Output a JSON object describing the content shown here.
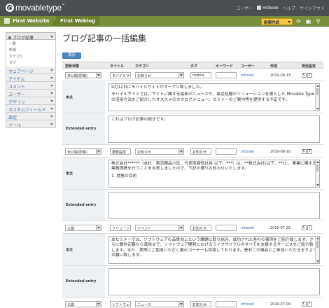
{
  "header": {
    "logo": "movabletype",
    "logo_tm": "™",
    "user_label": "ユーザー",
    "user_name": "mtbook",
    "help": "ヘルプ",
    "signout": "サインアウト"
  },
  "nav": {
    "site": "First Website",
    "blog": "First Weblog",
    "new_button": "新規作成"
  },
  "sidebar": {
    "blog_entries": "ブログ記事",
    "sub_items": [
      "一覧",
      "新規",
      "カテゴリ",
      "タグ"
    ],
    "items": [
      "ウェブページ",
      "アイテム",
      "コメント",
      "ユーザー",
      "デザイン",
      "カスタムフィールド",
      "設定",
      "ツール"
    ]
  },
  "main": {
    "title": "ブログ記事の一括編集",
    "save": "保存",
    "columns": {
      "status": "更新状態",
      "title": "タイトル",
      "category": "カテゴリ",
      "tags": "タグ",
      "keywords": "キーワード",
      "author": "ユーザー",
      "date": "作成",
      "feedback": "受信設定"
    },
    "body_label": "本文",
    "extended_label": "Extended entry",
    "comment_labels": [
      "C",
      "T"
    ]
  },
  "entries": [
    {
      "status": "未公開(原稿)",
      "title": "モバイルサ",
      "category": "お知らせ",
      "tags": "mobile",
      "keywords": "",
      "author": "mtbook",
      "date": "2010-08-13",
      "body": [
        "9月12日にモバイルサイトがオープン致しました。",
        "モバイルサイトでは、サイトに関する最新のニュースや、最近話題のソリューションを導入した Movable Type の活用方法をご紹介したオススメのカタログメニュー、セミナーのご案内等を提供する予定です。"
      ],
      "extended": "これはブログ記事の続きです。"
    },
    {
      "status": "未公開(原稿)",
      "title": "業務提携",
      "category": "お知らせ",
      "tags": "お知らせ,",
      "keywords": "",
      "author": "mtbook",
      "date": "2010-08-10",
      "body": [
        "株式会社******（本社：東京都品川区、代表取締役社長 以下、***）は、**株式会社(以下、**)と、事業に関する業務提携を行うことを合意しましたので、下記の通りお知らせいたします。",
        "1. 提携の目的"
      ],
      "extended": ""
    },
    {
      "status": "公開",
      "title": "ソリューシ",
      "category": "イベント",
      "tags": "お知らせ,",
      "keywords": "",
      "author": "mtbook",
      "date": "2010-07-25",
      "body": [
        "本セミナーでは、ソフトウェアの品質向上という課題に取り組み、成功された各社の事例をご紹介致します。さらに要件定義から運用まで、ソフトウェア開発におけるライフサイクルのすべてを支援するサービスをご紹介致します。また、実際にご使用いただく展示コーナーも併設しております。是非この機会にご参加いただきますようお願い致します。"
      ],
      "extended": ""
    },
    {
      "status": "公開",
      "title": "ソフトウェ",
      "category": "ニュース",
      "tags": "お知らせ,",
      "keywords": "",
      "author": "mtbook",
      "date": "2010-07-09"
    }
  ]
}
